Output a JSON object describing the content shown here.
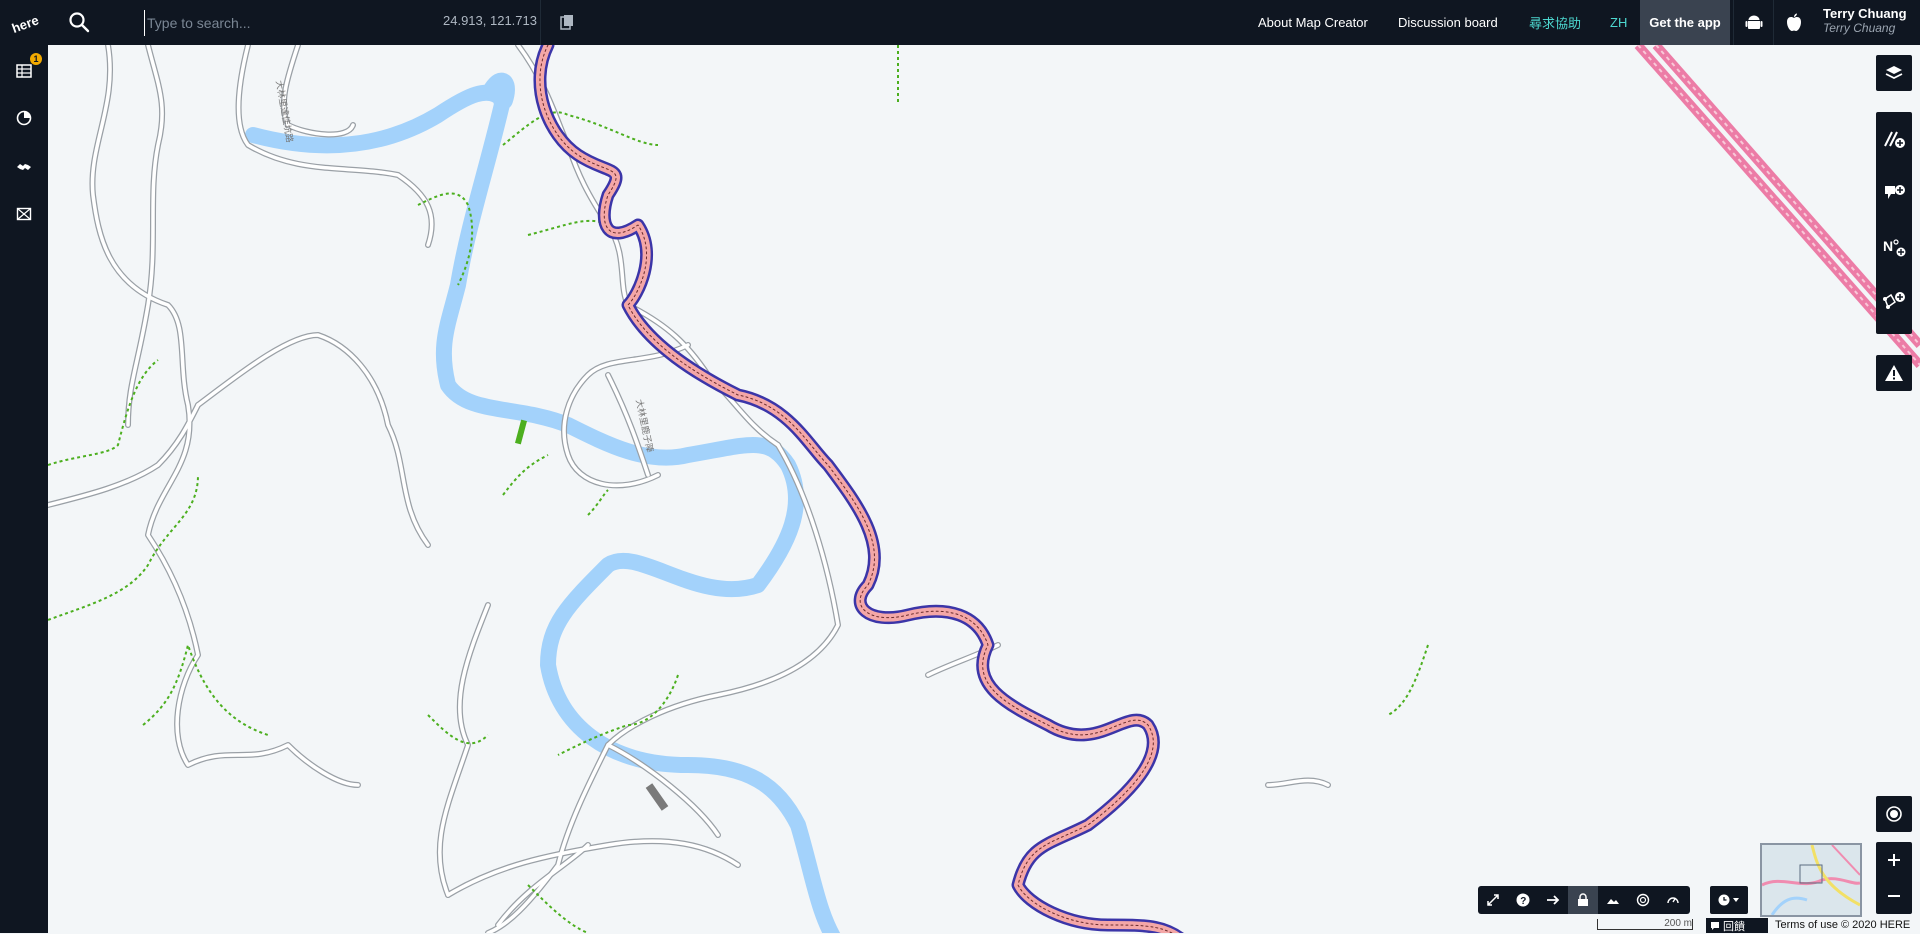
{
  "app": {
    "logo_text": "here"
  },
  "search": {
    "placeholder": "Type to search...",
    "value": "",
    "coordinates": "24.913, 121.713"
  },
  "nav": {
    "about": "About Map Creator",
    "discussion": "Discussion board",
    "help": "尋求協助",
    "lang": "ZH",
    "get_app": "Get the app"
  },
  "user": {
    "name": "Terry Chuang",
    "display": "Terry Chuang"
  },
  "sidebar": {
    "badge_count": "1"
  },
  "map": {
    "road_labels": [
      "大林里達佳坑路",
      "大林里鹿子陣"
    ]
  },
  "scale": {
    "label": "200 m"
  },
  "footer": {
    "feedback_label": "回饋",
    "terms": "Terms of use © 2020 HERE"
  },
  "colors": {
    "topbar": "#0f1621",
    "map_bg": "#f3f6f8",
    "river": "#a3d2fb",
    "highlight_road": "#3b35a8",
    "road_fill": "#f4a7a7",
    "trail": "#4caf1f",
    "highway_pink": "#ec7ca6",
    "help_link": "#4dd8d0"
  }
}
